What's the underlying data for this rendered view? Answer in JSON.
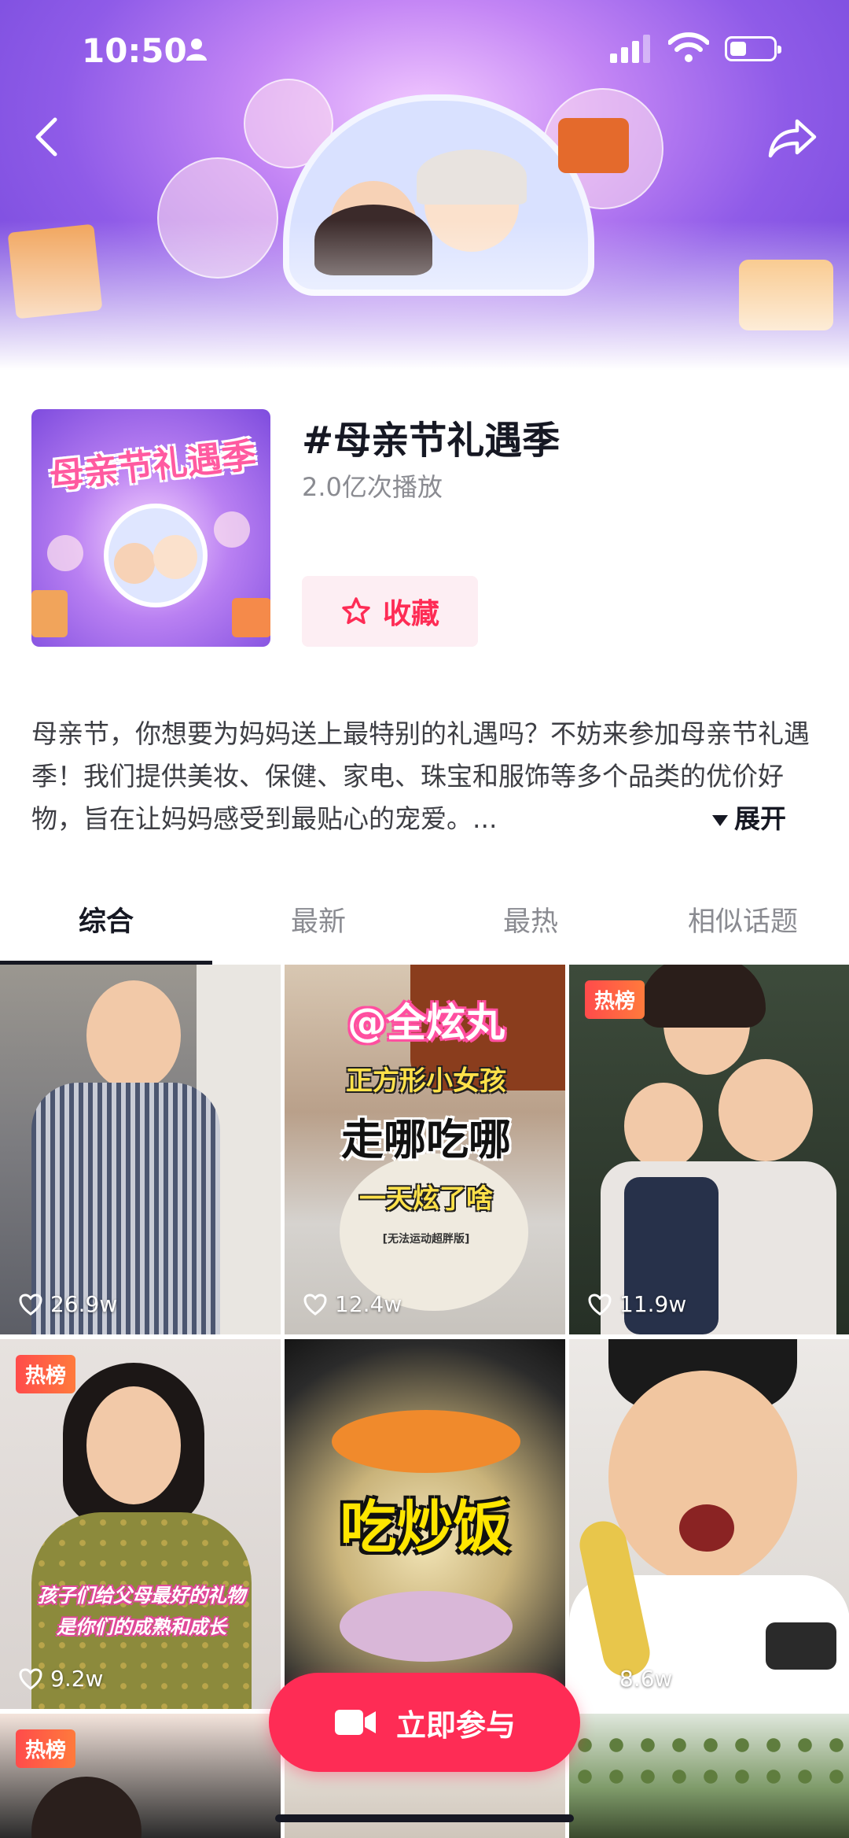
{
  "status_bar": {
    "time": "10:50"
  },
  "topic": {
    "cover_title": "母亲节礼遇季",
    "title": "#母亲节礼遇季",
    "play_count": "2.0亿次播放",
    "collect_label": "收藏",
    "description": "母亲节，你想要为妈妈送上最特别的礼遇吗？不妨来参加母亲节礼遇季！我们提供美妆、保健、家电、珠宝和服饰等多个品类的优价好物，旨在让妈妈感受到最贴心的宠爱。...",
    "expand_label": "展开"
  },
  "tabs": [
    {
      "label": "综合",
      "active": true
    },
    {
      "label": "最新",
      "active": false
    },
    {
      "label": "最热",
      "active": false
    },
    {
      "label": "相似话题",
      "active": false
    }
  ],
  "videos": [
    {
      "likes": "26.9w",
      "hot": false,
      "caption": ""
    },
    {
      "likes": "12.4w",
      "hot": false,
      "caption": "@全炫丸",
      "caption2": "正方形小女孩",
      "caption3": "走哪吃哪",
      "caption4": "一天炫了啥",
      "caption5": "[无法运动超胖版]"
    },
    {
      "likes": "11.9w",
      "hot": true,
      "caption": ""
    },
    {
      "likes": "9.2w",
      "hot": true,
      "caption": "孩子们给父母最好的礼物",
      "caption2": "是你们的成熟和成长"
    },
    {
      "likes": "",
      "hot": false,
      "caption": "吃炒饭"
    },
    {
      "likes": "8.6w",
      "hot": false,
      "caption": ""
    },
    {
      "likes": "",
      "hot": true,
      "caption": ""
    },
    {
      "likes": "",
      "hot": false,
      "caption": ""
    },
    {
      "likes": "",
      "hot": false,
      "caption": ""
    }
  ],
  "hot_badge": "热榜",
  "join_button": "立即参与",
  "colors": {
    "accent": "#fe2c55",
    "hero_purple": "#8f5be8"
  }
}
